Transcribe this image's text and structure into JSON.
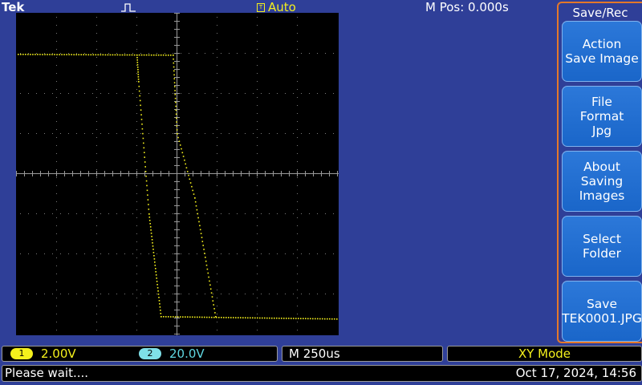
{
  "header": {
    "brand": "Tek",
    "trigger_mode": "Auto",
    "trigger_glyph": "T",
    "trigger_icon": "pulse-edge-icon",
    "position_readout": "M Pos: 0.000s"
  },
  "side_menu": {
    "title": "Save/Rec",
    "items": [
      {
        "lines": [
          "Action",
          "Save Image"
        ]
      },
      {
        "lines": [
          "File",
          "Format",
          "Jpg"
        ]
      },
      {
        "lines": [
          "About",
          "Saving",
          "Images"
        ]
      },
      {
        "lines": [
          "Select",
          "Folder"
        ]
      },
      {
        "lines": [
          "Save",
          "TEK0001.JPG"
        ]
      }
    ]
  },
  "status": {
    "ch1_num": "1",
    "ch1_scale": "2.00V",
    "ch2_num": "2",
    "ch2_scale": "20.0V",
    "timebase": "M 250us",
    "display_mode": "XY Mode"
  },
  "message": {
    "text": "Please wait....",
    "datetime": "Oct 17, 2024, 14:56"
  },
  "colors": {
    "background": "#2f3f98",
    "ch1": "#f4f01c",
    "ch2": "#5fd6e0",
    "menu_border": "#e4782a",
    "menu_button": "#1a66c9"
  }
}
